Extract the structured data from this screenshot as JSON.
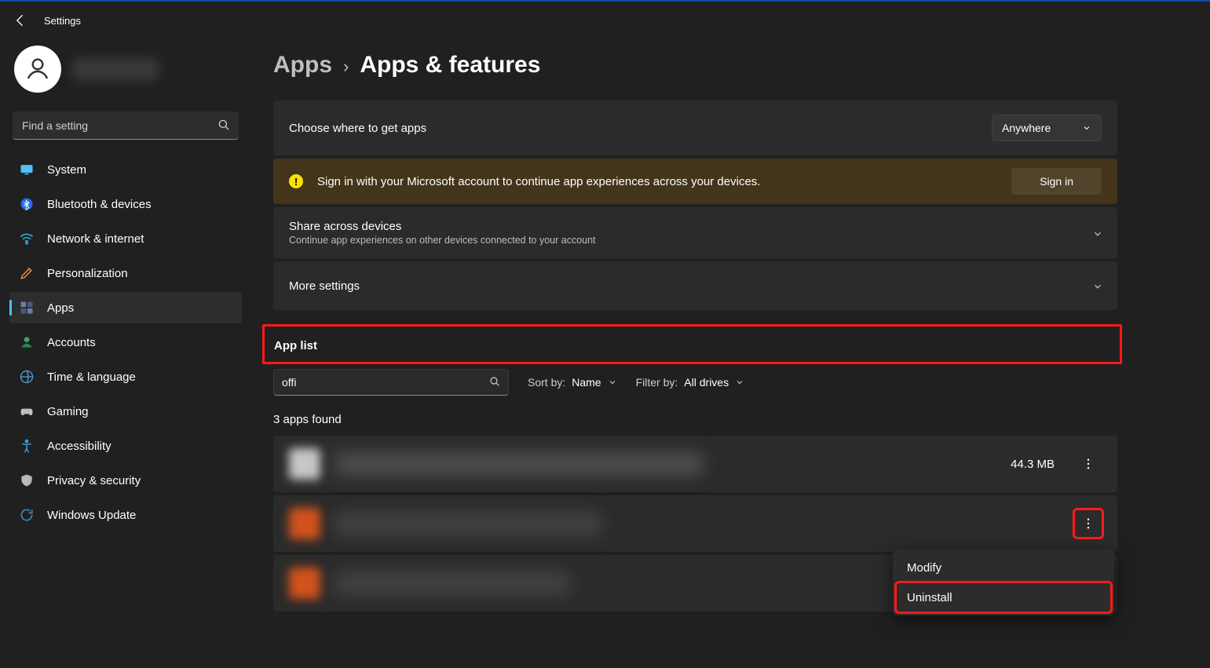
{
  "window": {
    "title": "Settings"
  },
  "search": {
    "placeholder": "Find a setting"
  },
  "nav": {
    "items": [
      {
        "label": "System"
      },
      {
        "label": "Bluetooth & devices"
      },
      {
        "label": "Network & internet"
      },
      {
        "label": "Personalization"
      },
      {
        "label": "Apps"
      },
      {
        "label": "Accounts"
      },
      {
        "label": "Time & language"
      },
      {
        "label": "Gaming"
      },
      {
        "label": "Accessibility"
      },
      {
        "label": "Privacy & security"
      },
      {
        "label": "Windows Update"
      }
    ]
  },
  "breadcrumb": {
    "parent": "Apps",
    "current": "Apps & features"
  },
  "source": {
    "label": "Choose where to get apps",
    "value": "Anywhere"
  },
  "banner": {
    "text": "Sign in with your Microsoft account to continue app experiences across your devices.",
    "button": "Sign in"
  },
  "share": {
    "title": "Share across devices",
    "subtitle": "Continue app experiences on other devices connected to your account"
  },
  "moreSettings": {
    "label": "More settings"
  },
  "appList": {
    "heading": "App list",
    "searchValue": "offi",
    "sortLabel": "Sort by:",
    "sortValue": "Name",
    "filterLabel": "Filter by:",
    "filterValue": "All drives",
    "resultsText": "3 apps found",
    "rows": [
      {
        "size": "44.3 MB"
      },
      {
        "size": ""
      },
      {
        "size": ""
      }
    ]
  },
  "contextMenu": {
    "modify": "Modify",
    "uninstall": "Uninstall"
  }
}
